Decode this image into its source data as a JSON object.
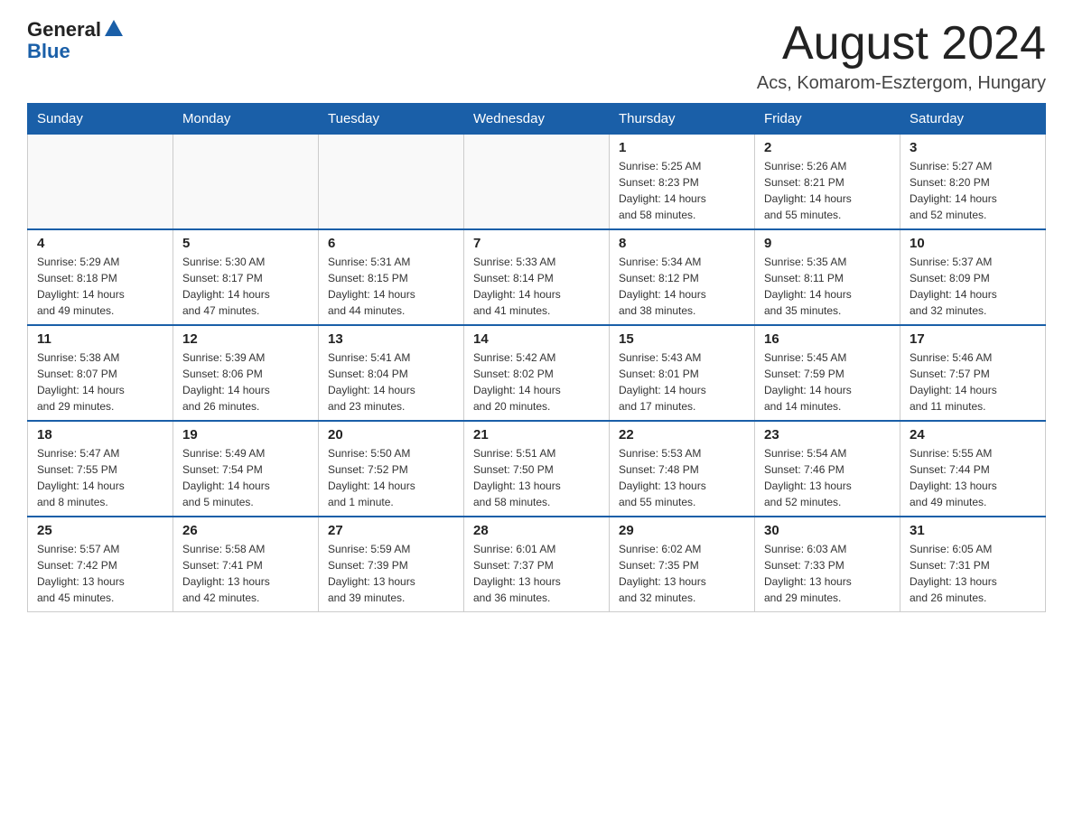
{
  "header": {
    "logo_general": "General",
    "logo_blue": "Blue",
    "title": "August 2024",
    "subtitle": "Acs, Komarom-Esztergom, Hungary"
  },
  "days_of_week": [
    "Sunday",
    "Monday",
    "Tuesday",
    "Wednesday",
    "Thursday",
    "Friday",
    "Saturday"
  ],
  "weeks": [
    [
      {
        "day": "",
        "info": ""
      },
      {
        "day": "",
        "info": ""
      },
      {
        "day": "",
        "info": ""
      },
      {
        "day": "",
        "info": ""
      },
      {
        "day": "1",
        "info": "Sunrise: 5:25 AM\nSunset: 8:23 PM\nDaylight: 14 hours\nand 58 minutes."
      },
      {
        "day": "2",
        "info": "Sunrise: 5:26 AM\nSunset: 8:21 PM\nDaylight: 14 hours\nand 55 minutes."
      },
      {
        "day": "3",
        "info": "Sunrise: 5:27 AM\nSunset: 8:20 PM\nDaylight: 14 hours\nand 52 minutes."
      }
    ],
    [
      {
        "day": "4",
        "info": "Sunrise: 5:29 AM\nSunset: 8:18 PM\nDaylight: 14 hours\nand 49 minutes."
      },
      {
        "day": "5",
        "info": "Sunrise: 5:30 AM\nSunset: 8:17 PM\nDaylight: 14 hours\nand 47 minutes."
      },
      {
        "day": "6",
        "info": "Sunrise: 5:31 AM\nSunset: 8:15 PM\nDaylight: 14 hours\nand 44 minutes."
      },
      {
        "day": "7",
        "info": "Sunrise: 5:33 AM\nSunset: 8:14 PM\nDaylight: 14 hours\nand 41 minutes."
      },
      {
        "day": "8",
        "info": "Sunrise: 5:34 AM\nSunset: 8:12 PM\nDaylight: 14 hours\nand 38 minutes."
      },
      {
        "day": "9",
        "info": "Sunrise: 5:35 AM\nSunset: 8:11 PM\nDaylight: 14 hours\nand 35 minutes."
      },
      {
        "day": "10",
        "info": "Sunrise: 5:37 AM\nSunset: 8:09 PM\nDaylight: 14 hours\nand 32 minutes."
      }
    ],
    [
      {
        "day": "11",
        "info": "Sunrise: 5:38 AM\nSunset: 8:07 PM\nDaylight: 14 hours\nand 29 minutes."
      },
      {
        "day": "12",
        "info": "Sunrise: 5:39 AM\nSunset: 8:06 PM\nDaylight: 14 hours\nand 26 minutes."
      },
      {
        "day": "13",
        "info": "Sunrise: 5:41 AM\nSunset: 8:04 PM\nDaylight: 14 hours\nand 23 minutes."
      },
      {
        "day": "14",
        "info": "Sunrise: 5:42 AM\nSunset: 8:02 PM\nDaylight: 14 hours\nand 20 minutes."
      },
      {
        "day": "15",
        "info": "Sunrise: 5:43 AM\nSunset: 8:01 PM\nDaylight: 14 hours\nand 17 minutes."
      },
      {
        "day": "16",
        "info": "Sunrise: 5:45 AM\nSunset: 7:59 PM\nDaylight: 14 hours\nand 14 minutes."
      },
      {
        "day": "17",
        "info": "Sunrise: 5:46 AM\nSunset: 7:57 PM\nDaylight: 14 hours\nand 11 minutes."
      }
    ],
    [
      {
        "day": "18",
        "info": "Sunrise: 5:47 AM\nSunset: 7:55 PM\nDaylight: 14 hours\nand 8 minutes."
      },
      {
        "day": "19",
        "info": "Sunrise: 5:49 AM\nSunset: 7:54 PM\nDaylight: 14 hours\nand 5 minutes."
      },
      {
        "day": "20",
        "info": "Sunrise: 5:50 AM\nSunset: 7:52 PM\nDaylight: 14 hours\nand 1 minute."
      },
      {
        "day": "21",
        "info": "Sunrise: 5:51 AM\nSunset: 7:50 PM\nDaylight: 13 hours\nand 58 minutes."
      },
      {
        "day": "22",
        "info": "Sunrise: 5:53 AM\nSunset: 7:48 PM\nDaylight: 13 hours\nand 55 minutes."
      },
      {
        "day": "23",
        "info": "Sunrise: 5:54 AM\nSunset: 7:46 PM\nDaylight: 13 hours\nand 52 minutes."
      },
      {
        "day": "24",
        "info": "Sunrise: 5:55 AM\nSunset: 7:44 PM\nDaylight: 13 hours\nand 49 minutes."
      }
    ],
    [
      {
        "day": "25",
        "info": "Sunrise: 5:57 AM\nSunset: 7:42 PM\nDaylight: 13 hours\nand 45 minutes."
      },
      {
        "day": "26",
        "info": "Sunrise: 5:58 AM\nSunset: 7:41 PM\nDaylight: 13 hours\nand 42 minutes."
      },
      {
        "day": "27",
        "info": "Sunrise: 5:59 AM\nSunset: 7:39 PM\nDaylight: 13 hours\nand 39 minutes."
      },
      {
        "day": "28",
        "info": "Sunrise: 6:01 AM\nSunset: 7:37 PM\nDaylight: 13 hours\nand 36 minutes."
      },
      {
        "day": "29",
        "info": "Sunrise: 6:02 AM\nSunset: 7:35 PM\nDaylight: 13 hours\nand 32 minutes."
      },
      {
        "day": "30",
        "info": "Sunrise: 6:03 AM\nSunset: 7:33 PM\nDaylight: 13 hours\nand 29 minutes."
      },
      {
        "day": "31",
        "info": "Sunrise: 6:05 AM\nSunset: 7:31 PM\nDaylight: 13 hours\nand 26 minutes."
      }
    ]
  ]
}
